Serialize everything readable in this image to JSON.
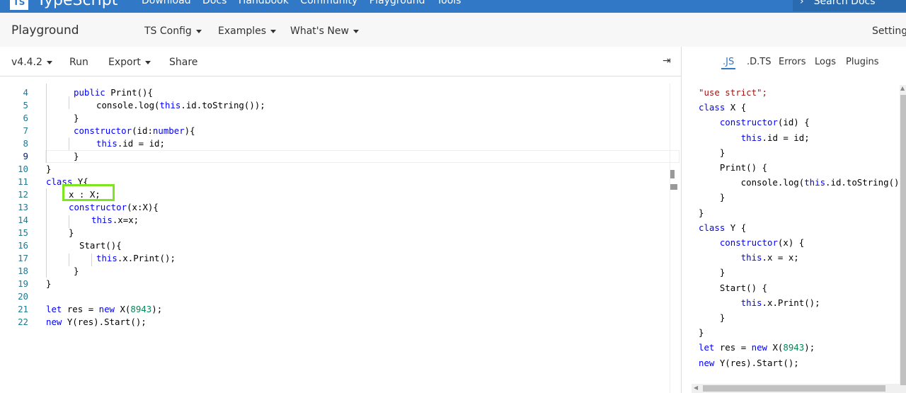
{
  "topnav": {
    "logo": "TS",
    "brand": "TypeScript",
    "links": [
      "Download",
      "Docs",
      "Handbook",
      "Community",
      "Playground",
      "Tools"
    ],
    "search_label": "Search Docs"
  },
  "subbar": {
    "title": "Playground",
    "menus": [
      "TS Config",
      "Examples",
      "What's New"
    ],
    "settings": "Settings"
  },
  "toolbar": {
    "version": "v4.4.2",
    "run": "Run",
    "export": "Export",
    "share": "Share",
    "collapse_icon": "⇥"
  },
  "editor": {
    "line_numbers": [
      "4",
      "5",
      "6",
      "7",
      "8",
      "9",
      "10",
      "11",
      "12",
      "13",
      "14",
      "15",
      "16",
      "17",
      "18",
      "19",
      "20",
      "21",
      "22"
    ]
  },
  "output_tabs": [
    ".JS",
    ".D.TS",
    "Errors",
    "Logs",
    "Plugins"
  ],
  "output_header": "\"use strict\";",
  "colors": {
    "brand_blue": "#3178c6",
    "highlight_green": "#7ee521",
    "keyword": "#0000ff",
    "number": "#098658",
    "line_number": "#237893"
  }
}
